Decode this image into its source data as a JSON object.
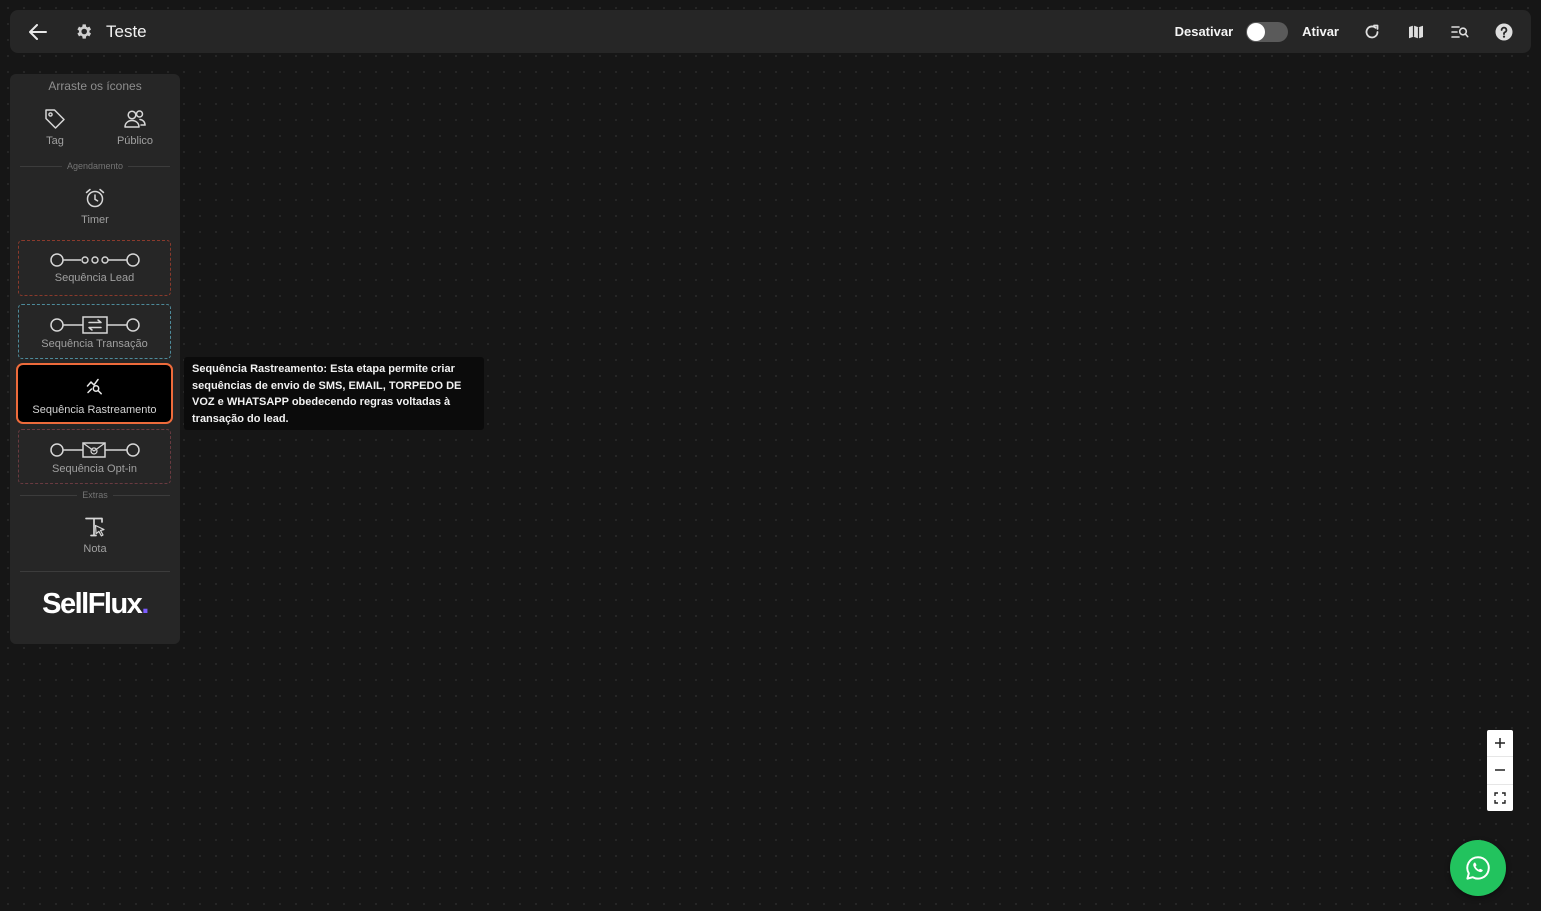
{
  "header": {
    "title": "Teste",
    "toggle_off_label": "Desativar",
    "toggle_on_label": "Ativar",
    "toggle_state": "off"
  },
  "sidebar": {
    "drag_hint": "Arraste os ícones",
    "tools": {
      "tag": "Tag",
      "publico": "Público",
      "timer": "Timer",
      "nota": "Nota"
    },
    "sections": {
      "agendamento": "Agendamento",
      "extras": "Extras"
    },
    "sequences": {
      "lead": "Sequência Lead",
      "transacao": "Sequência Transação",
      "rastreamento": "Sequência Rastreamento",
      "optin": "Sequência Opt-in"
    },
    "logo_text": "SellFlux",
    "logo_dot": "."
  },
  "tooltip": {
    "text": "Sequência Rastreamento: Esta etapa permite criar sequências de envio de SMS, EMAIL, TORPEDO DE VOZ e WHATSAPP obedecendo regras voltadas à transação do lead."
  },
  "colors": {
    "canvas_bg": "#161616",
    "panel_bg": "#262626",
    "active_border": "#ee6b3b",
    "lead_border": "#8a3a2c",
    "transacao_border": "#4d8a9a",
    "optin_border": "#6a3a40",
    "whatsapp": "#22c35e",
    "logo_dot": "#7c5cff"
  },
  "icons": {
    "back": "arrow-left-icon",
    "settings": "gear-icon",
    "refresh": "refresh-icon",
    "map": "map-icon",
    "search_list": "list-search-icon",
    "help": "help-circle-icon",
    "zoom_in": "plus-icon",
    "zoom_out": "minus-icon",
    "fit": "fit-screen-icon",
    "whatsapp": "whatsapp-icon"
  }
}
